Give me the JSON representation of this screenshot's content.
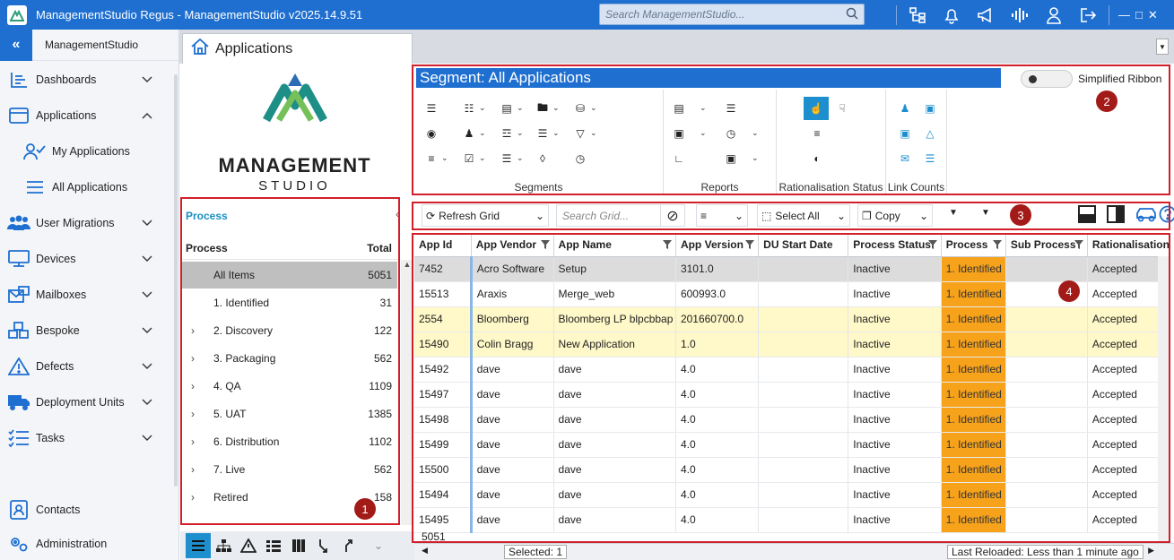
{
  "window": {
    "title": "ManagementStudio Regus - ManagementStudio v2025.14.9.51",
    "search_placeholder": "Search ManagementStudio...",
    "brand_color": "#1e6fd0"
  },
  "nav": {
    "header": "ManagementStudio",
    "items": [
      {
        "label": "Dashboards",
        "icon": "dashboard-icon"
      },
      {
        "label": "Applications",
        "icon": "applications-icon"
      },
      {
        "label": "My Applications",
        "icon": "user-check-icon"
      },
      {
        "label": "All Applications",
        "icon": "list-icon"
      },
      {
        "label": "User Migrations",
        "icon": "users-icon"
      },
      {
        "label": "Devices",
        "icon": "monitor-icon"
      },
      {
        "label": "Mailboxes",
        "icon": "mailbox-icon"
      },
      {
        "label": "Bespoke",
        "icon": "cubes-icon"
      },
      {
        "label": "Defects",
        "icon": "warning-icon"
      },
      {
        "label": "Deployment Units",
        "icon": "truck-icon"
      },
      {
        "label": "Tasks",
        "icon": "tasks-icon"
      },
      {
        "label": "Contacts",
        "icon": "contact-icon"
      },
      {
        "label": "Administration",
        "icon": "gears-icon"
      }
    ]
  },
  "tab": {
    "label": "Applications"
  },
  "logo": {
    "line1": "MANAGEMENT",
    "line2": "STUDIO"
  },
  "process_panel": {
    "title": "Process",
    "col_name": "Process",
    "col_total": "Total",
    "rows": [
      {
        "name": "All Items",
        "total": "5051",
        "expandable": false
      },
      {
        "name": "1. Identified",
        "total": "31",
        "expandable": false
      },
      {
        "name": "2. Discovery",
        "total": "122",
        "expandable": true
      },
      {
        "name": "3. Packaging",
        "total": "562",
        "expandable": true
      },
      {
        "name": "4. QA",
        "total": "1109",
        "expandable": true
      },
      {
        "name": "5. UAT",
        "total": "1385",
        "expandable": true
      },
      {
        "name": "6. Distribution",
        "total": "1102",
        "expandable": true
      },
      {
        "name": "7. Live",
        "total": "562",
        "expandable": true
      },
      {
        "name": "Retired",
        "total": "158",
        "expandable": true
      }
    ]
  },
  "ribbon": {
    "segment_title": "Segment: All Applications",
    "simplified_label": "Simplified Ribbon",
    "groups": [
      "Segments",
      "Reports",
      "Rationalisation Status",
      "Link Counts"
    ]
  },
  "grid_toolbar": {
    "refresh": "Refresh Grid",
    "search_placeholder": "Search Grid...",
    "select_all": "Select All",
    "copy": "Copy"
  },
  "badges": [
    "1",
    "2",
    "3",
    "4"
  ],
  "grid": {
    "columns": [
      "App Id",
      "App Vendor",
      "App Name",
      "App Version",
      "DU Start Date",
      "Process Status",
      "Process",
      "Sub Process",
      "Rationalisation"
    ],
    "rows": [
      {
        "id": "7452",
        "vendor": "Acro Software",
        "name": "Setup",
        "version": "3101.0",
        "du": "",
        "status": "Inactive",
        "process": "1. Identified",
        "sub": "",
        "rat": "Accepted",
        "style": "sel"
      },
      {
        "id": "15513",
        "vendor": "Araxis",
        "name": "Merge_web",
        "version": "600993.0",
        "du": "",
        "status": "Inactive",
        "process": "1. Identified",
        "sub": "",
        "rat": "Accepted",
        "style": ""
      },
      {
        "id": "2554",
        "vendor": "Bloomberg",
        "name": "Bloomberg LP blpcbbap",
        "version": "201660700.0",
        "du": "",
        "status": "Inactive",
        "process": "1. Identified",
        "sub": "",
        "rat": "Accepted",
        "style": "yel"
      },
      {
        "id": "15490",
        "vendor": "Colin Bragg",
        "name": "New Application",
        "version": "1.0",
        "du": "",
        "status": "Inactive",
        "process": "1. Identified",
        "sub": "",
        "rat": "Accepted",
        "style": "yel"
      },
      {
        "id": "15492",
        "vendor": "dave",
        "name": "dave",
        "version": "4.0",
        "du": "",
        "status": "Inactive",
        "process": "1. Identified",
        "sub": "",
        "rat": "Accepted",
        "style": ""
      },
      {
        "id": "15497",
        "vendor": "dave",
        "name": "dave",
        "version": "4.0",
        "du": "",
        "status": "Inactive",
        "process": "1. Identified",
        "sub": "",
        "rat": "Accepted",
        "style": ""
      },
      {
        "id": "15498",
        "vendor": "dave",
        "name": "dave",
        "version": "4.0",
        "du": "",
        "status": "Inactive",
        "process": "1. Identified",
        "sub": "",
        "rat": "Accepted",
        "style": ""
      },
      {
        "id": "15499",
        "vendor": "dave",
        "name": "dave",
        "version": "4.0",
        "du": "",
        "status": "Inactive",
        "process": "1. Identified",
        "sub": "",
        "rat": "Accepted",
        "style": ""
      },
      {
        "id": "15500",
        "vendor": "dave",
        "name": "dave",
        "version": "4.0",
        "du": "",
        "status": "Inactive",
        "process": "1. Identified",
        "sub": "",
        "rat": "Accepted",
        "style": ""
      },
      {
        "id": "15494",
        "vendor": "dave",
        "name": "dave",
        "version": "4.0",
        "du": "",
        "status": "Inactive",
        "process": "1. Identified",
        "sub": "",
        "rat": "Accepted",
        "style": ""
      },
      {
        "id": "15495",
        "vendor": "dave",
        "name": "dave",
        "version": "4.0",
        "du": "",
        "status": "Inactive",
        "process": "1. Identified",
        "sub": "",
        "rat": "Accepted",
        "style": ""
      }
    ],
    "footer_count": "5051"
  },
  "status": {
    "selected": "Selected: 1",
    "last_reloaded": "Last Reloaded: Less than 1 minute ago"
  }
}
